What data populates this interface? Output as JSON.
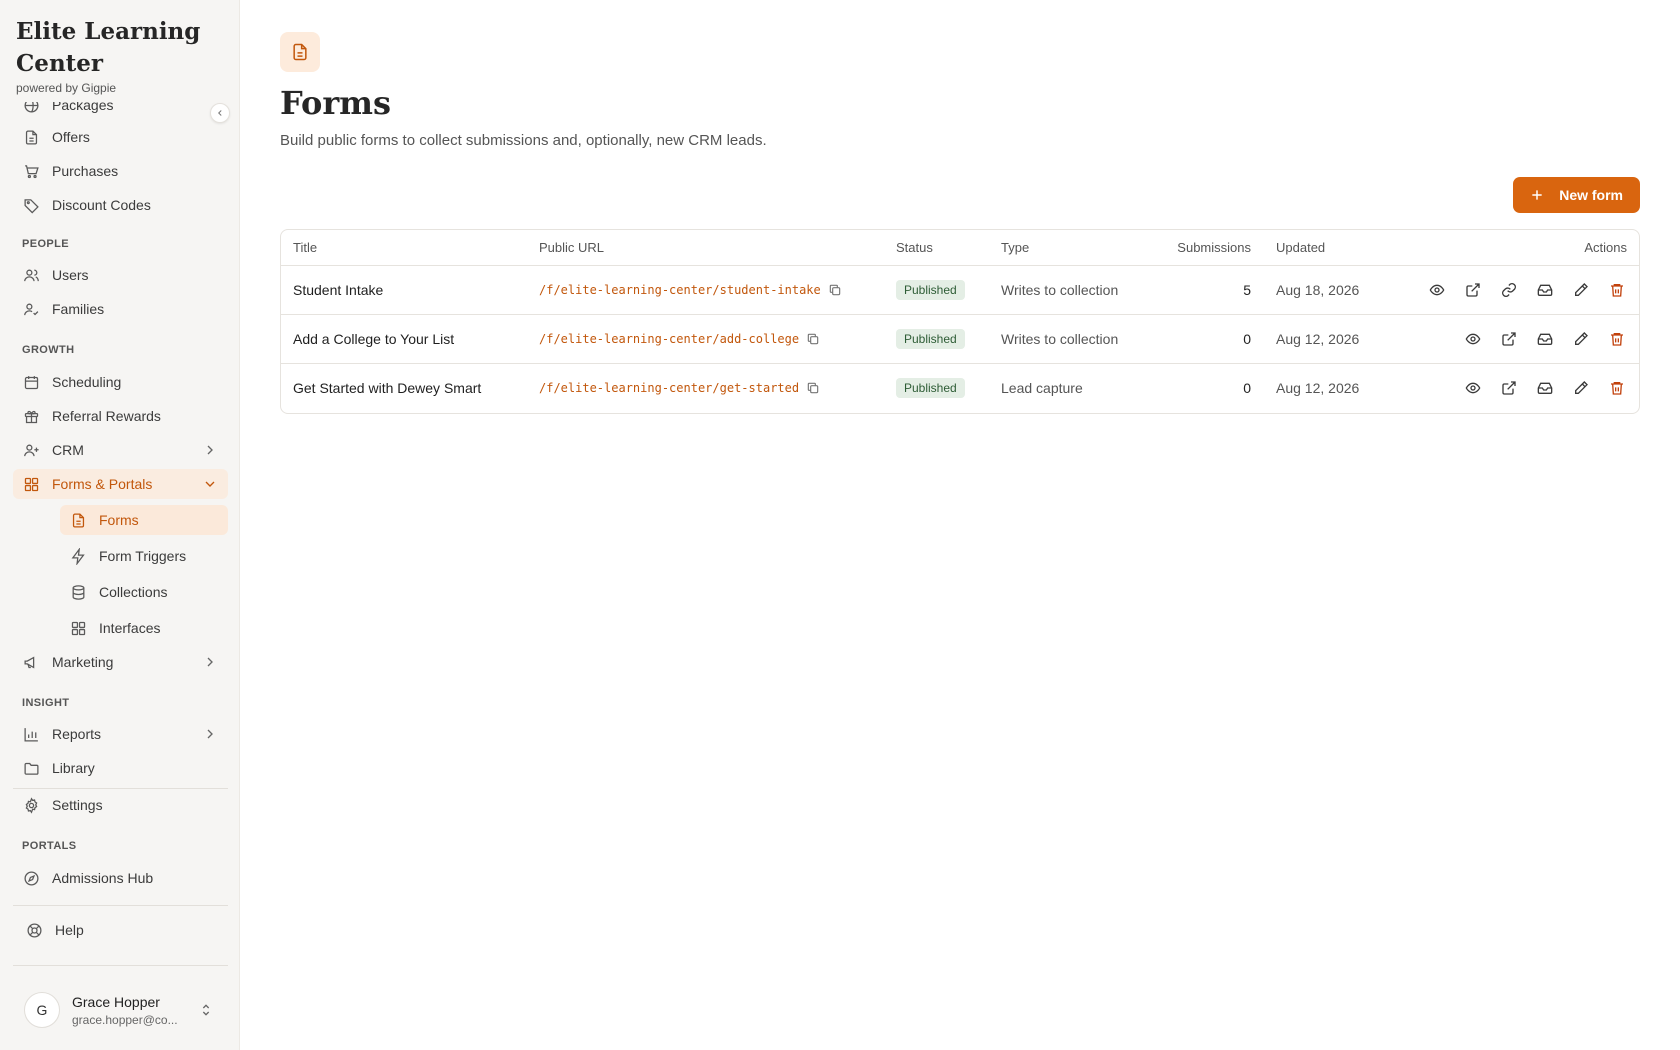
{
  "brand": {
    "title": "Elite Learning Center",
    "subtitle": "powered by Gigpie"
  },
  "nav": {
    "packages": "Packages",
    "offers": "Offers",
    "purchases": "Purchases",
    "discount_codes": "Discount Codes",
    "section_people": "PEOPLE",
    "users": "Users",
    "families": "Families",
    "section_growth": "GROWTH",
    "scheduling": "Scheduling",
    "referral_rewards": "Referral Rewards",
    "crm": "CRM",
    "forms_portals": "Forms & Portals",
    "forms": "Forms",
    "form_triggers": "Form Triggers",
    "collections": "Collections",
    "interfaces": "Interfaces",
    "marketing": "Marketing",
    "section_insight": "INSIGHT",
    "reports": "Reports",
    "library": "Library",
    "settings": "Settings",
    "section_portals": "PORTALS",
    "admissions_hub": "Admissions Hub",
    "help": "Help"
  },
  "user": {
    "initial": "G",
    "name": "Grace Hopper",
    "email": "grace.hopper@co..."
  },
  "page": {
    "title": "Forms",
    "description": "Build public forms to collect submissions and, optionally, new CRM leads.",
    "new_button": "New form"
  },
  "table": {
    "headers": {
      "title": "Title",
      "url": "Public URL",
      "status": "Status",
      "type": "Type",
      "submissions": "Submissions",
      "updated": "Updated",
      "actions": "Actions"
    },
    "rows": [
      {
        "title": "Student Intake",
        "url": "/f/elite-learning-center/student-intake",
        "status": "Published",
        "type": "Writes to collection",
        "submissions": "5",
        "updated": "Aug 18, 2026"
      },
      {
        "title": "Add a College to Your List",
        "url": "/f/elite-learning-center/add-college",
        "status": "Published",
        "type": "Writes to collection",
        "submissions": "0",
        "updated": "Aug 12, 2026"
      },
      {
        "title": "Get Started with Dewey Smart",
        "url": "/f/elite-learning-center/get-started",
        "status": "Published",
        "type": "Lead capture",
        "submissions": "0",
        "updated": "Aug 12, 2026"
      }
    ]
  },
  "colors": {
    "accent": "#d9650f",
    "accent_text": "#c2570c",
    "status_bg": "#e4eee5",
    "sidebar_bg": "#f6f5f3"
  }
}
